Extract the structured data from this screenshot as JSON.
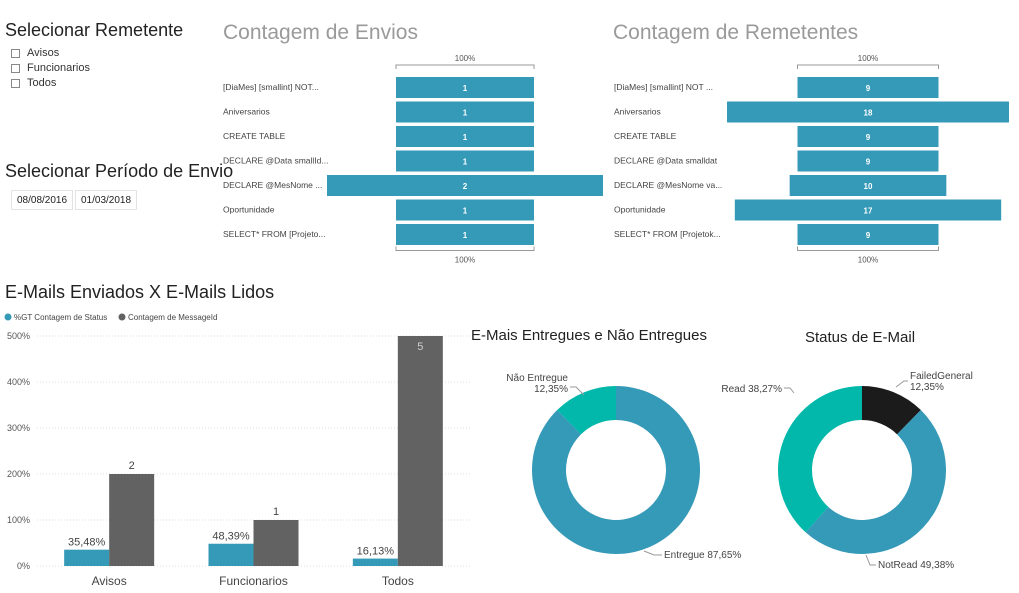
{
  "slicer_remetente": {
    "title": "Selecionar Remetente",
    "options": [
      "Avisos",
      "Funcionarios",
      "Todos"
    ]
  },
  "slicer_periodo": {
    "title": "Selecionar Período de Envio",
    "start": "08/08/2016",
    "end": "01/03/2018"
  },
  "colors": {
    "teal": "#3599b8",
    "gray": "#626262",
    "green": "#01b8aa",
    "black": "#1b1b1b"
  },
  "chart_data": [
    {
      "id": "envios",
      "type": "bar",
      "orientation": "funnel",
      "title": "Contagem de Envios",
      "top_label": "100%",
      "bottom_label": "100%",
      "categories": [
        "[DiaMes] [smallint] NOT...",
        "Aniversarios",
        "CREATE TABLE",
        "DECLARE @Data smallId...",
        "DECLARE @MesNome ...",
        "Oportunidade",
        "SELECT* FROM [Projeto..."
      ],
      "values": [
        1,
        1,
        1,
        1,
        2,
        1,
        1
      ]
    },
    {
      "id": "remetentes",
      "type": "bar",
      "orientation": "funnel",
      "title": "Contagem de Remetentes",
      "top_label": "100%",
      "bottom_label": "100%",
      "categories": [
        "[DiaMes] [smallint] NOT ...",
        "Aniversarios",
        "CREATE TABLE",
        "DECLARE @Data smalldat",
        "DECLARE @MesNome va...",
        "Oportunidade",
        "SELECT* FROM [Projetok..."
      ],
      "values": [
        9,
        18,
        9,
        9,
        10,
        17,
        9
      ]
    },
    {
      "id": "enviados_lidos",
      "type": "bar",
      "title": "E-Mails Enviados X E-Mails Lidos",
      "categories": [
        "Avisos",
        "Funcionarios",
        "Todos"
      ],
      "y_ticks": [
        "500%",
        "400%",
        "300%",
        "200%",
        "100%",
        "0%"
      ],
      "ylim": [
        0,
        500
      ],
      "legend_position": "top-left",
      "series": [
        {
          "name": "%GT Contagem de Status",
          "values": [
            35.48,
            48.39,
            16.13
          ],
          "labels": [
            "35,48%",
            "48,39%",
            "16,13%"
          ],
          "color": "#3599b8"
        },
        {
          "name": "Contagem de MessageId",
          "values": [
            2,
            1,
            5
          ],
          "labels": [
            "2",
            "1",
            "5"
          ],
          "color": "#626262"
        }
      ]
    },
    {
      "id": "entregues",
      "type": "pie",
      "title": "E-Mais Entregues e Não Entregues",
      "slices": [
        {
          "label": "Não Entregue",
          "pct": "12,35%",
          "value": 12.35,
          "color": "#01b8aa"
        },
        {
          "label": "Entregue",
          "pct": "87,65%",
          "value": 87.65,
          "color": "#3599b8"
        }
      ],
      "label_texts": [
        "Não Entregue",
        "12,35%",
        "Entregue 87,65%"
      ]
    },
    {
      "id": "status",
      "type": "pie",
      "title": "Status de E-Mail",
      "slices": [
        {
          "label": "FailedGeneral",
          "pct": "12,35%",
          "value": 12.35,
          "color": "#1b1b1b"
        },
        {
          "label": "NotRead",
          "pct": "49,38%",
          "value": 49.38,
          "color": "#3599b8"
        },
        {
          "label": "Read",
          "pct": "38,27%",
          "value": 38.27,
          "color": "#01b8aa"
        }
      ],
      "label_texts": [
        "FailedGeneral",
        "12,35%",
        "Read 38,27%",
        "NotRead 49,38%"
      ]
    }
  ]
}
